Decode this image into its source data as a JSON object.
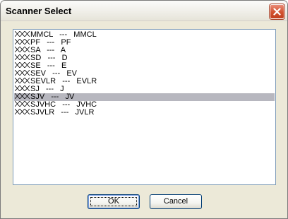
{
  "window": {
    "title": "Scanner Select"
  },
  "list": {
    "prefix_icon": "xxx-placeholder-glyph",
    "selected_index": 8,
    "items": [
      "MMCL   ---   MMCL",
      "PF   ---   PF",
      "SA   ---   A",
      "SD   ---   D",
      "SE   ---   E",
      "SEV   ---   EV",
      "SEVLR   ---   EVLR",
      "SJ   ---   J",
      "SJV   ---   JV",
      "SJVHC   ---   JVHC",
      "SJVLR   ---   JVLR"
    ]
  },
  "buttons": {
    "ok_label": "OK",
    "cancel_label": "Cancel"
  },
  "colors": {
    "dialog_bg": "#ece9d8",
    "selection": "#b7b7bf",
    "close_button": "#d2512f",
    "list_border": "#7f9db9"
  }
}
